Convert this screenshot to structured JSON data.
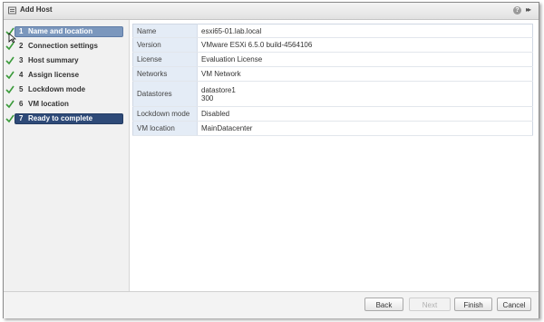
{
  "dialog": {
    "title": "Add Host"
  },
  "titlebar": {
    "help_glyph": "?",
    "expand_glyph": "▸▸"
  },
  "steps": [
    {
      "num": "1",
      "label": "Name and location",
      "done": true,
      "state": "current"
    },
    {
      "num": "2",
      "label": "Connection settings",
      "done": true
    },
    {
      "num": "3",
      "label": "Host summary",
      "done": true
    },
    {
      "num": "4",
      "label": "Assign license",
      "done": true
    },
    {
      "num": "5",
      "label": "Lockdown mode",
      "done": true
    },
    {
      "num": "6",
      "label": "VM location",
      "done": true
    },
    {
      "num": "7",
      "label": "Ready to complete",
      "done": true,
      "state": "active"
    }
  ],
  "summary": {
    "rows": [
      {
        "key": "Name",
        "value": "esxi65-01.lab.local"
      },
      {
        "key": "Version",
        "value": "VMware ESXi 6.5.0 build-4564106"
      },
      {
        "key": "License",
        "value": "Evaluation License"
      },
      {
        "key": "Networks",
        "value": "VM Network"
      },
      {
        "key": "Datastores",
        "value": "datastore1",
        "value2": "300"
      },
      {
        "key": "Lockdown mode",
        "value": "Disabled"
      },
      {
        "key": "VM location",
        "value": "MainDatacenter"
      }
    ]
  },
  "footer": {
    "back": "Back",
    "next": "Next",
    "finish": "Finish",
    "cancel": "Cancel"
  },
  "colors": {
    "check": "#3a9a3a",
    "step_current": "#7b97bd",
    "step_active": "#2e4a78",
    "key_cell": "#e4ecf6"
  }
}
